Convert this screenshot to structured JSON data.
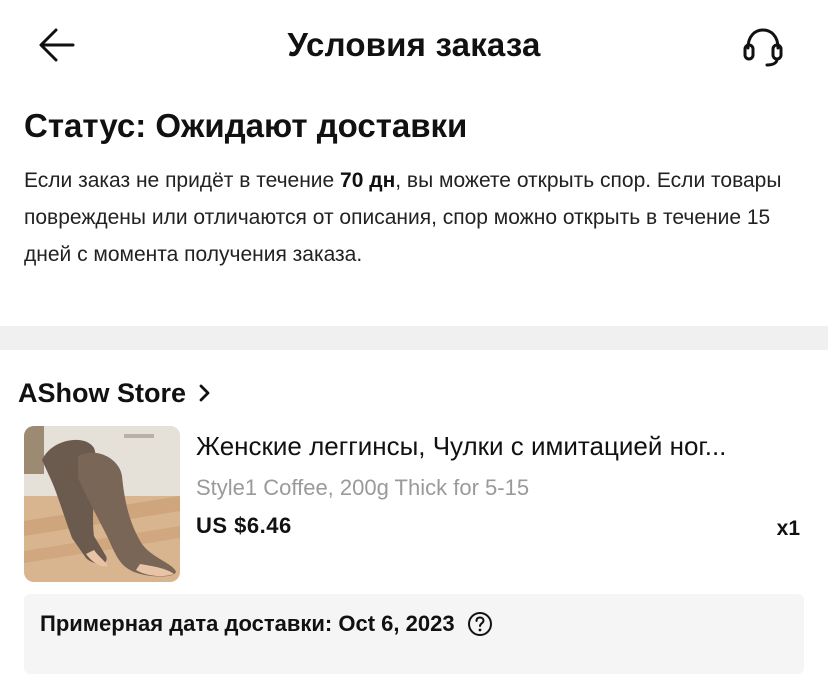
{
  "header": {
    "title": "Условия заказа",
    "back_icon": "arrow-left-icon",
    "support_icon": "headset-icon"
  },
  "status": {
    "title": "Статус: Ожидают доставки",
    "desc_part1": "Если заказ не придёт в течение ",
    "desc_bold": "70 дн",
    "desc_part2": ", вы можете открыть спор. Если товары повреждены или отличаются от описания, спор можно открыть в течение 15 дней с момента получения заказа."
  },
  "store": {
    "name": "AShow Store",
    "chevron_icon": "chevron-right-icon"
  },
  "product": {
    "title": "Женские леггинсы, Чулки с имитацией ног...",
    "variant": "Style1 Coffee, 200g Thick for 5-15",
    "price": "US $6.46",
    "quantity": "x1"
  },
  "delivery": {
    "text": "Примерная дата доставки: Oct 6, 2023",
    "help_icon": "question-circle-icon"
  },
  "colors": {
    "text": "#111111",
    "muted": "#9a9a9a",
    "divider": "#f0f0f0",
    "panel": "#f5f5f5"
  }
}
